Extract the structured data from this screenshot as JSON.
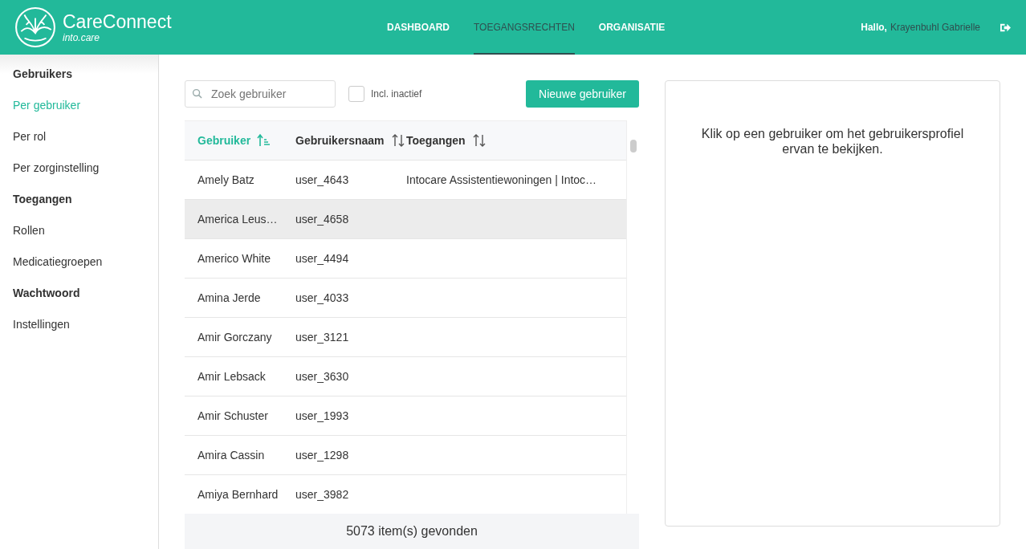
{
  "header": {
    "brand": "CareConnect",
    "tagline": "into.care",
    "nav": [
      {
        "label": "DASHBOARD",
        "selected": false
      },
      {
        "label": "TOEGANGSRECHTEN",
        "selected": true
      },
      {
        "label": "ORGANISATIE",
        "selected": false
      }
    ],
    "greeting": "Hallo,",
    "user": "Krayenbuhl Gabrielle"
  },
  "sidebar": {
    "sections": [
      {
        "title": "Gebruikers",
        "items": [
          {
            "label": "Per gebruiker",
            "selected": true
          },
          {
            "label": "Per rol",
            "selected": false
          },
          {
            "label": "Per zorginstelling",
            "selected": false
          }
        ]
      },
      {
        "title": "Toegangen",
        "items": [
          {
            "label": "Rollen",
            "selected": false
          },
          {
            "label": "Medicatiegroepen",
            "selected": false
          }
        ]
      },
      {
        "title": "Wachtwoord",
        "items": [
          {
            "label": "Instellingen",
            "selected": false
          }
        ]
      }
    ]
  },
  "toolbar": {
    "search": {
      "placeholder": "Zoek gebruiker"
    },
    "include_inactive": {
      "label": "Incl. inactief",
      "checked": false
    },
    "new_button": "Nieuwe gebruiker"
  },
  "table": {
    "columns": [
      {
        "label": "Gebruiker",
        "sorted": true
      },
      {
        "label": "Gebruikersnaam",
        "sorted": false
      },
      {
        "label": "Toegangen",
        "sorted": false
      }
    ],
    "rows": [
      {
        "name": "Amely Batz",
        "username": "user_4643",
        "access": "Intocare Assistentiewoningen | Intoc…",
        "highlighted": false
      },
      {
        "name": "America Leus…",
        "username": "user_4658",
        "access": "",
        "highlighted": true
      },
      {
        "name": "Americo White",
        "username": "user_4494",
        "access": "",
        "highlighted": false
      },
      {
        "name": "Amina Jerde",
        "username": "user_4033",
        "access": "",
        "highlighted": false
      },
      {
        "name": "Amir Gorczany",
        "username": "user_3121",
        "access": "",
        "highlighted": false
      },
      {
        "name": "Amir Lebsack",
        "username": "user_3630",
        "access": "",
        "highlighted": false
      },
      {
        "name": "Amir Schuster",
        "username": "user_1993",
        "access": "",
        "highlighted": false
      },
      {
        "name": "Amira Cassin",
        "username": "user_1298",
        "access": "",
        "highlighted": false
      },
      {
        "name": "Amiya Bernhard",
        "username": "user_3982",
        "access": "",
        "highlighted": false
      }
    ],
    "footer": "5073 item(s) gevonden"
  },
  "detail": {
    "message": "Klik op een gebruiker om het gebruikersprofiel ervan te bekijken."
  }
}
